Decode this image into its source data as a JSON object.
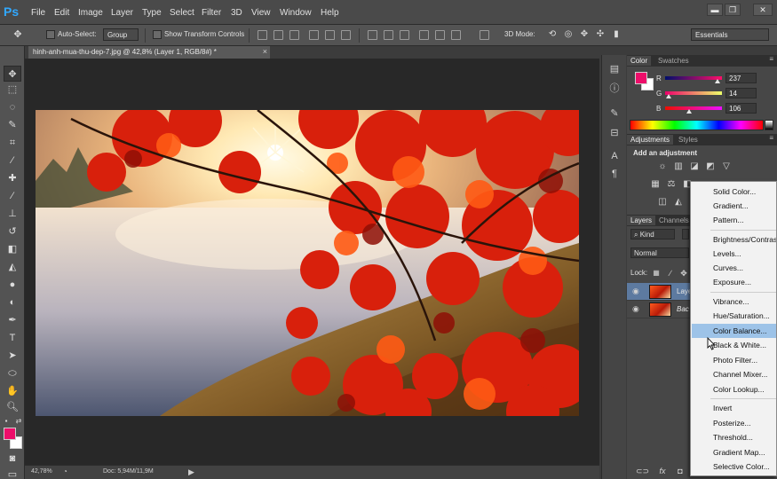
{
  "app": {
    "logo": "Ps",
    "menu": [
      "File",
      "Edit",
      "Image",
      "Layer",
      "Type",
      "Select",
      "Filter",
      "3D",
      "View",
      "Window",
      "Help"
    ],
    "window_controls": [
      "▬",
      "❐",
      "✕"
    ]
  },
  "options_bar": {
    "auto_select_label": "Auto-Select:",
    "auto_select_value": "Group",
    "show_transform_label": "Show Transform Controls",
    "mode_label": "3D Mode:",
    "workspace": "Essentials"
  },
  "document": {
    "tab_title": "hinh-anh-mua-thu-dep-7.jpg @ 42,8% (Layer 1, RGB/8#) *",
    "close": "×"
  },
  "status_bar": {
    "zoom": "42,78%",
    "doc_size": "Doc: 5,94M/11,9M"
  },
  "color_panel": {
    "tabs": [
      "Color",
      "Swatches"
    ],
    "r_label": "R",
    "g_label": "G",
    "b_label": "B",
    "r": "237",
    "g": "14",
    "b": "106",
    "foreground": "#ed0e6a",
    "background": "#ffffff"
  },
  "adjustments_panel": {
    "tabs": [
      "Adjustments",
      "Styles"
    ],
    "heading": "Add an adjustment"
  },
  "layers_panel": {
    "tabs": [
      "Layers",
      "Channels"
    ],
    "kind": "Kind",
    "blend_mode": "Normal",
    "lock_label": "Lock:",
    "layers": [
      {
        "name": "Laye",
        "selected": true
      },
      {
        "name": "Bac",
        "selected": false
      }
    ]
  },
  "context_menu": {
    "groups": [
      [
        "Solid Color...",
        "Gradient...",
        "Pattern..."
      ],
      [
        "Brightness/Contrast...",
        "Levels...",
        "Curves...",
        "Exposure..."
      ],
      [
        "Vibrance...",
        "Hue/Saturation...",
        "Color Balance...",
        "Black & White...",
        "Photo Filter...",
        "Channel Mixer...",
        "Color Lookup..."
      ],
      [
        "Invert",
        "Posterize...",
        "Threshold...",
        "Gradient Map...",
        "Selective Color..."
      ]
    ],
    "hovered": "Color Balance..."
  }
}
